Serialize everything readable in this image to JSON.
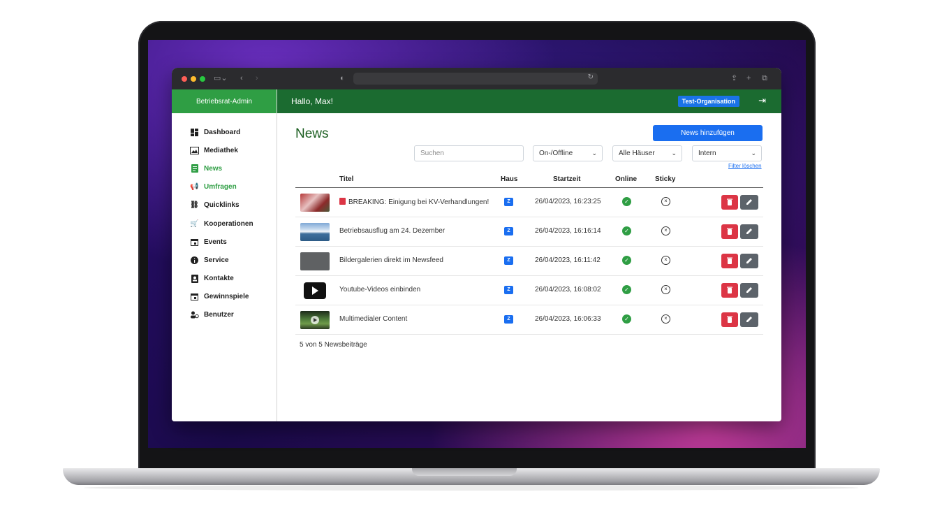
{
  "app": {
    "brand": "Betriebsrat-Admin",
    "greeting": "Hallo, Max!",
    "organization": "Test-Organisation"
  },
  "sidebar": {
    "items": [
      {
        "label": "Dashboard",
        "icon": "dashboard-icon",
        "active": false
      },
      {
        "label": "Mediathek",
        "icon": "photo-library-icon",
        "active": false
      },
      {
        "label": "News",
        "icon": "article-icon",
        "active": true
      },
      {
        "label": "Umfragen",
        "icon": "megaphone-icon",
        "active": true
      },
      {
        "label": "Quicklinks",
        "icon": "link-icon",
        "active": false
      },
      {
        "label": "Kooperationen",
        "icon": "cart-icon",
        "active": false
      },
      {
        "label": "Events",
        "icon": "calendar-icon",
        "active": false
      },
      {
        "label": "Service",
        "icon": "info-icon",
        "active": false
      },
      {
        "label": "Kontakte",
        "icon": "contacts-icon",
        "active": false
      },
      {
        "label": "Gewinnspiele",
        "icon": "calendar-icon",
        "active": false
      },
      {
        "label": "Benutzer",
        "icon": "users-icon",
        "active": false
      }
    ]
  },
  "page": {
    "title": "News",
    "add_button": "News hinzufügen",
    "search_placeholder": "Suchen",
    "filters": [
      "On-/Offline",
      "Alle Häuser",
      "Intern"
    ],
    "clear_filters": "Filter löschen",
    "columns": {
      "title": "Titel",
      "house": "Haus",
      "start": "Startzeit",
      "online": "Online",
      "sticky": "Sticky"
    },
    "rows": [
      {
        "title": "BREAKING: Einigung bei KV-Verhandlungen!",
        "badge": "Z",
        "start": "26/04/2023, 16:23:25",
        "thumb": "crowd-photo"
      },
      {
        "title": "Betriebsausflug am 24. Dezember",
        "badge": "Z",
        "start": "26/04/2023, 16:16:14",
        "thumb": "lake-photo"
      },
      {
        "title": "Bildergalerien direkt im Newsfeed",
        "badge": "Z",
        "start": "26/04/2023, 16:11:42",
        "thumb": "gallery-placeholder"
      },
      {
        "title": "Youtube-Videos einbinden",
        "badge": "Z",
        "start": "26/04/2023, 16:08:02",
        "thumb": "play-icon"
      },
      {
        "title": "Multimedialer Content",
        "badge": "Z",
        "start": "26/04/2023, 16:06:33",
        "thumb": "video-photo"
      }
    ],
    "count_text": "5 von 5 Newsbeiträge"
  },
  "colors": {
    "brand_green": "#2f9e44",
    "header_green": "#1b6b30",
    "primary_blue": "#1a6ef0",
    "danger": "#dc3545"
  }
}
